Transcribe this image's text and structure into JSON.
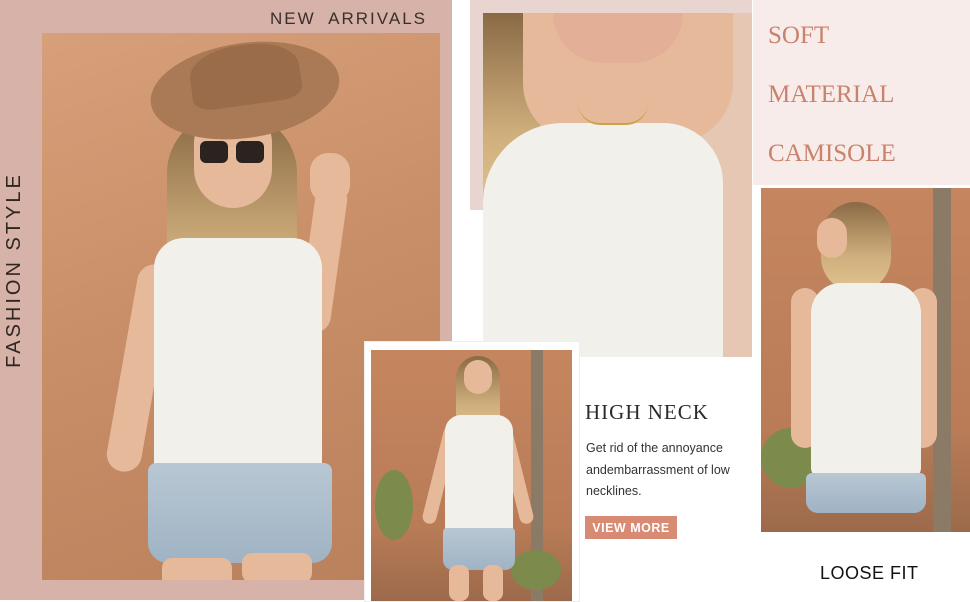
{
  "header": {
    "new_arrivals": "NEW  ARRIVALS"
  },
  "side_label": "FASHION STYLE",
  "feature_titles": {
    "soft": "SOFT",
    "material": "MATERIAL",
    "camisole": "CAMISOLE"
  },
  "high_neck": {
    "title": "HIGH NECK",
    "desc": "Get rid of the annoyance andembarrassment of low necklines.",
    "button": "VIEW MORE"
  },
  "loose_fit": "LOOSE FIT",
  "colors": {
    "pink": "#d7b2a8",
    "accent": "#c9826b",
    "button": "#d88a73"
  }
}
